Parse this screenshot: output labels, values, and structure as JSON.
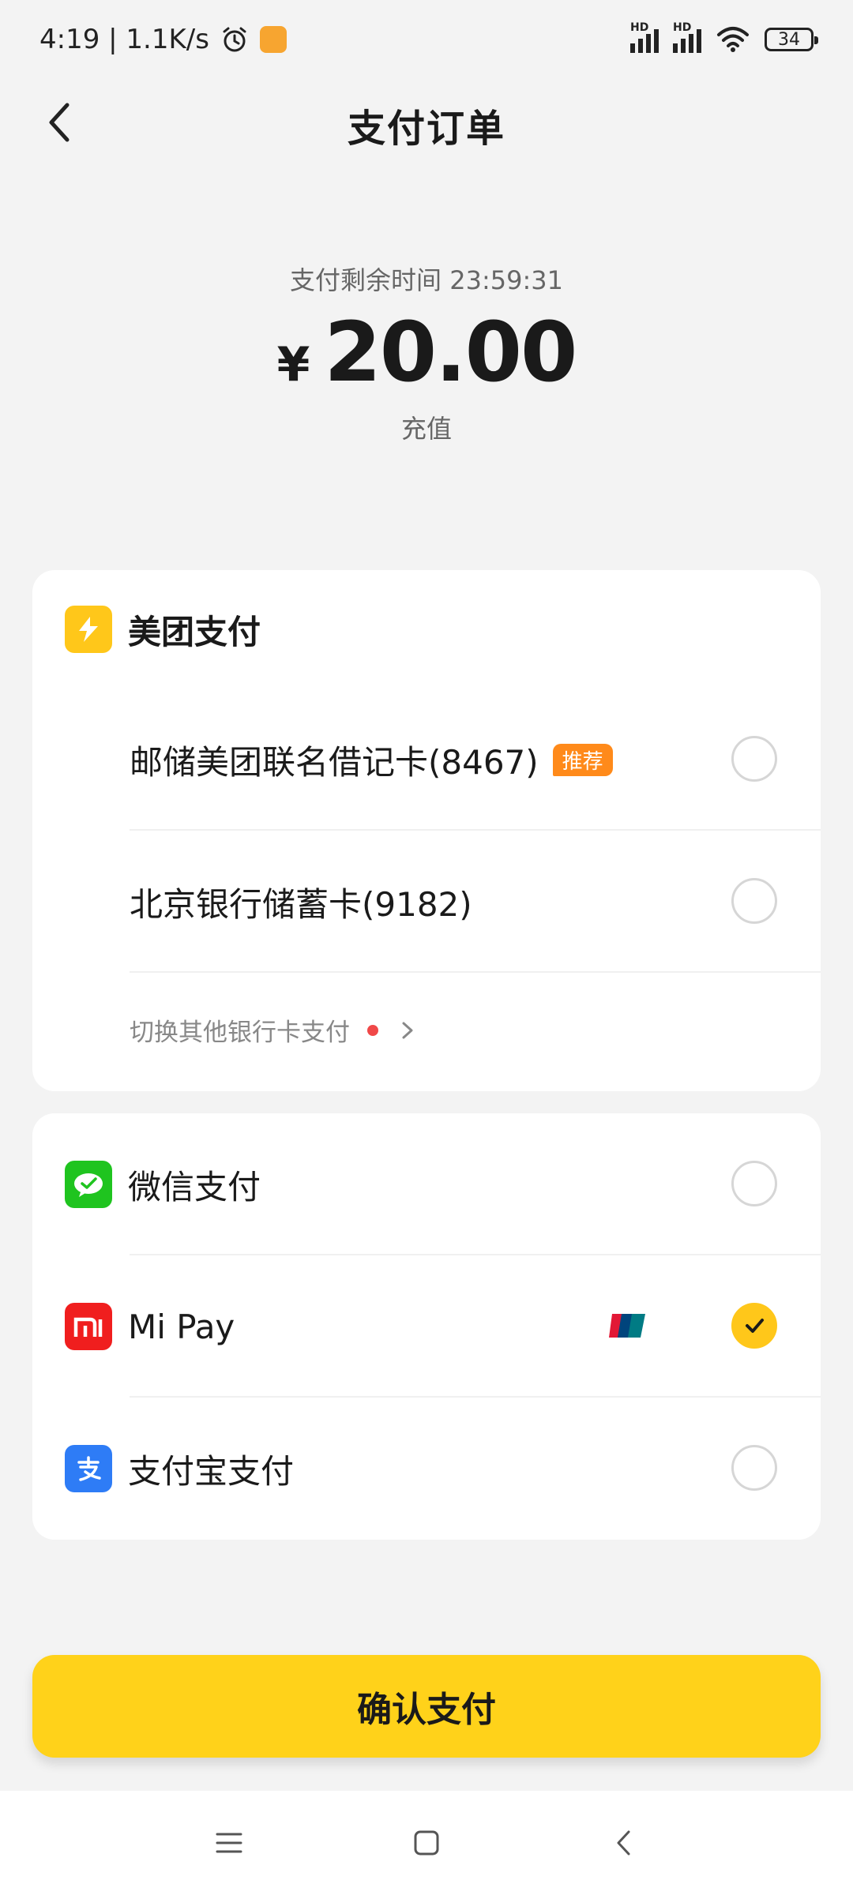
{
  "status_bar": {
    "time_speed": "4:19 | 1.1K/s",
    "signal_1_label": "HD",
    "signal_2_label": "HD",
    "battery": "34"
  },
  "header": {
    "title": "支付订单"
  },
  "order": {
    "timer": "支付剩余时间 23:59:31",
    "currency": "¥",
    "amount": "20.00",
    "purpose": "充值"
  },
  "meituan_group": {
    "title": "美团支付",
    "cards": [
      {
        "label": "邮储美团联名借记卡(8467)",
        "tag": "推荐",
        "selected": false
      },
      {
        "label": "北京银行储蓄卡(9182)",
        "selected": false
      }
    ],
    "switch_label": "切换其他银行卡支付"
  },
  "other_methods": [
    {
      "label": "微信支付",
      "icon": "wechat-pay-icon",
      "color": "#1fc41f",
      "selected": false
    },
    {
      "label": "Mi Pay",
      "icon": "mi-pay-icon",
      "color": "#f01e1e",
      "selected": true
    },
    {
      "label": "支付宝支付",
      "icon": "alipay-icon",
      "color": "#2e7cf6",
      "selected": false
    }
  ],
  "confirm_label": "确认支付",
  "colors": {
    "accent": "#ffd21a",
    "check": "#ffc71a",
    "tag": "#ff8a1a",
    "background": "#f3f3f3"
  }
}
